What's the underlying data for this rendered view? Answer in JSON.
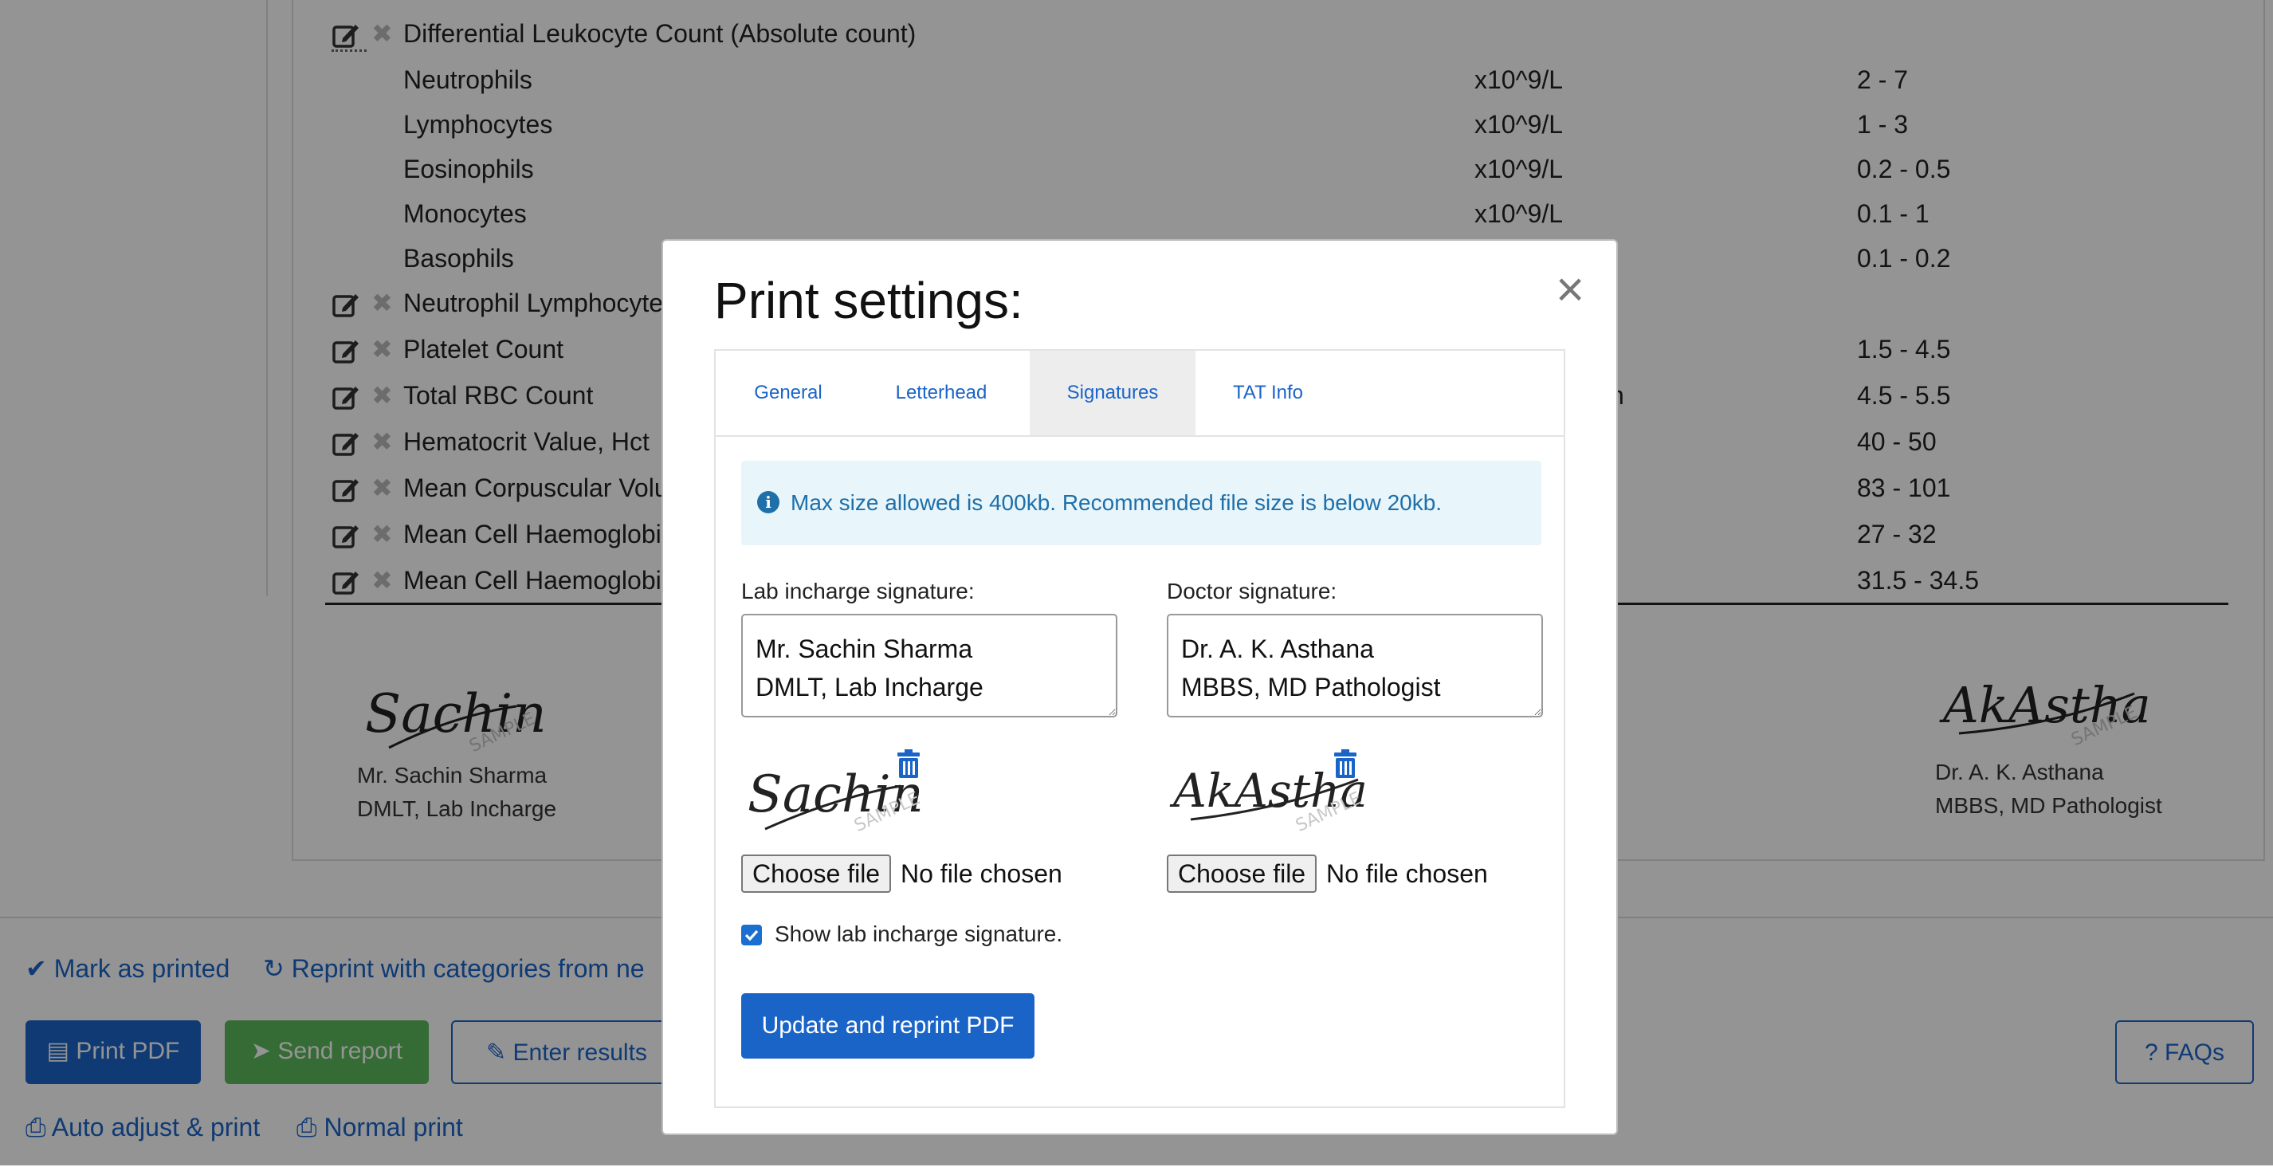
{
  "report": {
    "header_row": {
      "name": "Differential Leukocyte Count (Absolute count)"
    },
    "sub_rows": [
      {
        "name": "Neutrophils",
        "unit": "x10^9/L",
        "ref": "2 - 7"
      },
      {
        "name": "Lymphocytes",
        "unit": "x10^9/L",
        "ref": "1 - 3"
      },
      {
        "name": "Eosinophils",
        "unit": "x10^9/L",
        "ref": "0.2 - 0.5"
      },
      {
        "name": "Monocytes",
        "unit": "x10^9/L",
        "ref": "0.1 - 1"
      },
      {
        "name": "Basophils",
        "unit": "",
        "ref": "0.1 - 0.2"
      }
    ],
    "test_rows": [
      {
        "name": "Neutrophil Lymphocyte",
        "unit": "",
        "ref": ""
      },
      {
        "name": "Platelet Count",
        "unit": "",
        "ref": "1.5 - 4.5"
      },
      {
        "name": "Total RBC Count",
        "unit": "n",
        "ref": "4.5 - 5.5"
      },
      {
        "name": "Hematocrit Value, Hct",
        "unit": "",
        "ref": "40 - 50"
      },
      {
        "name": "Mean Corpuscular Volu",
        "unit": "",
        "ref": "83 - 101"
      },
      {
        "name": "Mean Cell Haemoglobi",
        "unit": "",
        "ref": "27 - 32"
      },
      {
        "name": "Mean Cell Haemoglobi",
        "unit": "",
        "ref": "31.5 - 34.5"
      }
    ],
    "left_signature": {
      "line1": "Mr. Sachin Sharma",
      "line2": "DMLT, Lab Incharge",
      "image_text": "Sachin",
      "watermark": "SAMPLE"
    },
    "right_signature": {
      "line1": "Dr. A. K. Asthana",
      "line2": "MBBS, MD Pathologist",
      "image_text": "AkAstha",
      "watermark": "SAMPLE"
    }
  },
  "bottom": {
    "mark_printed": "Mark as printed",
    "reprint": "Reprint with categories from ne",
    "print_pdf": "Print PDF",
    "send_report": "Send report",
    "enter_results": "Enter results",
    "faqs": "FAQs",
    "auto_adjust": "Auto adjust & print",
    "normal_print": "Normal print"
  },
  "colors": {
    "accent": "#1a64c8",
    "success": "#5cb85c",
    "info_bg": "#e8f6fc"
  },
  "modal": {
    "title": "Print settings:",
    "close": "×",
    "tabs": [
      {
        "label": "General"
      },
      {
        "label": "Letterhead"
      },
      {
        "label": "Signatures"
      },
      {
        "label": "TAT Info"
      }
    ],
    "active_tab": "Signatures",
    "info_text": "Max size allowed is 400kb. Recommended file size is below 20kb.",
    "lab_label": "Lab incharge signature:",
    "lab_value": "Mr. Sachin Sharma\nDMLT, Lab Incharge",
    "doctor_label": "Doctor signature:",
    "doctor_value": "Dr. A. K. Asthana\nMBBS, MD Pathologist",
    "choose_file": "Choose file",
    "no_file": "No file chosen",
    "show_lab_sig": "Show lab incharge signature.",
    "update_button": "Update and reprint PDF"
  }
}
